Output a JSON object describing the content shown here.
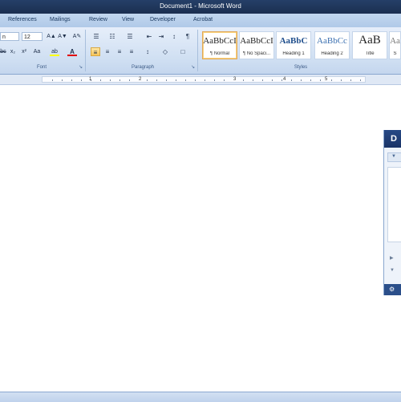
{
  "window": {
    "title": "Document1 - Microsoft Word"
  },
  "tabs": [
    "References",
    "Mailings",
    "Review",
    "View",
    "Developer",
    "Acrobat"
  ],
  "font": {
    "name": "n",
    "size": "12",
    "group_label": "Font"
  },
  "paragraph": {
    "group_label": "Paragraph"
  },
  "styles": {
    "group_label": "Styles",
    "items": [
      {
        "sample": "AaBbCcI",
        "name": "¶ Normal",
        "selected": true
      },
      {
        "sample": "AaBbCcI",
        "name": "¶ No Spaci...",
        "selected": false
      },
      {
        "sample": "AaBbC",
        "name": "Heading 1",
        "selected": false
      },
      {
        "sample": "AaBbCc",
        "name": "Heading 2",
        "selected": false
      },
      {
        "sample": "AaB",
        "name": "Title",
        "selected": false
      },
      {
        "sample": "Aa",
        "name": "S",
        "selected": false
      }
    ]
  },
  "ruler": {
    "numbers": [
      "1",
      "2",
      "3",
      "4",
      "5"
    ]
  },
  "side_panel": {
    "header": "D"
  },
  "icons": {
    "grow_font": "A▲",
    "shrink_font": "A▼",
    "clear_format": "A✎",
    "strikethrough": "abc",
    "subscript": "x₂",
    "superscript": "x²",
    "change_case": "Aa",
    "highlight": "ab",
    "font_color": "A",
    "bullets": "☰",
    "numbering": "☷",
    "multilevel": "☰",
    "decrease_indent": "⇤",
    "increase_indent": "⇥",
    "sort": "↕",
    "pilcrow": "¶",
    "align_left": "≡",
    "center": "≡",
    "align_right": "≡",
    "justify": "≡",
    "line_spacing": "↕",
    "shading": "◇",
    "borders": "□",
    "launcher": "↘",
    "scroll_up": "▲",
    "scroll_down": "▼",
    "scroll_right": "▶",
    "styles_more": "▾",
    "panel_gear": "⚙"
  },
  "colors": {
    "highlight": "#ffff00",
    "font_color": "#e00000",
    "title_bar": "#1f3557"
  }
}
